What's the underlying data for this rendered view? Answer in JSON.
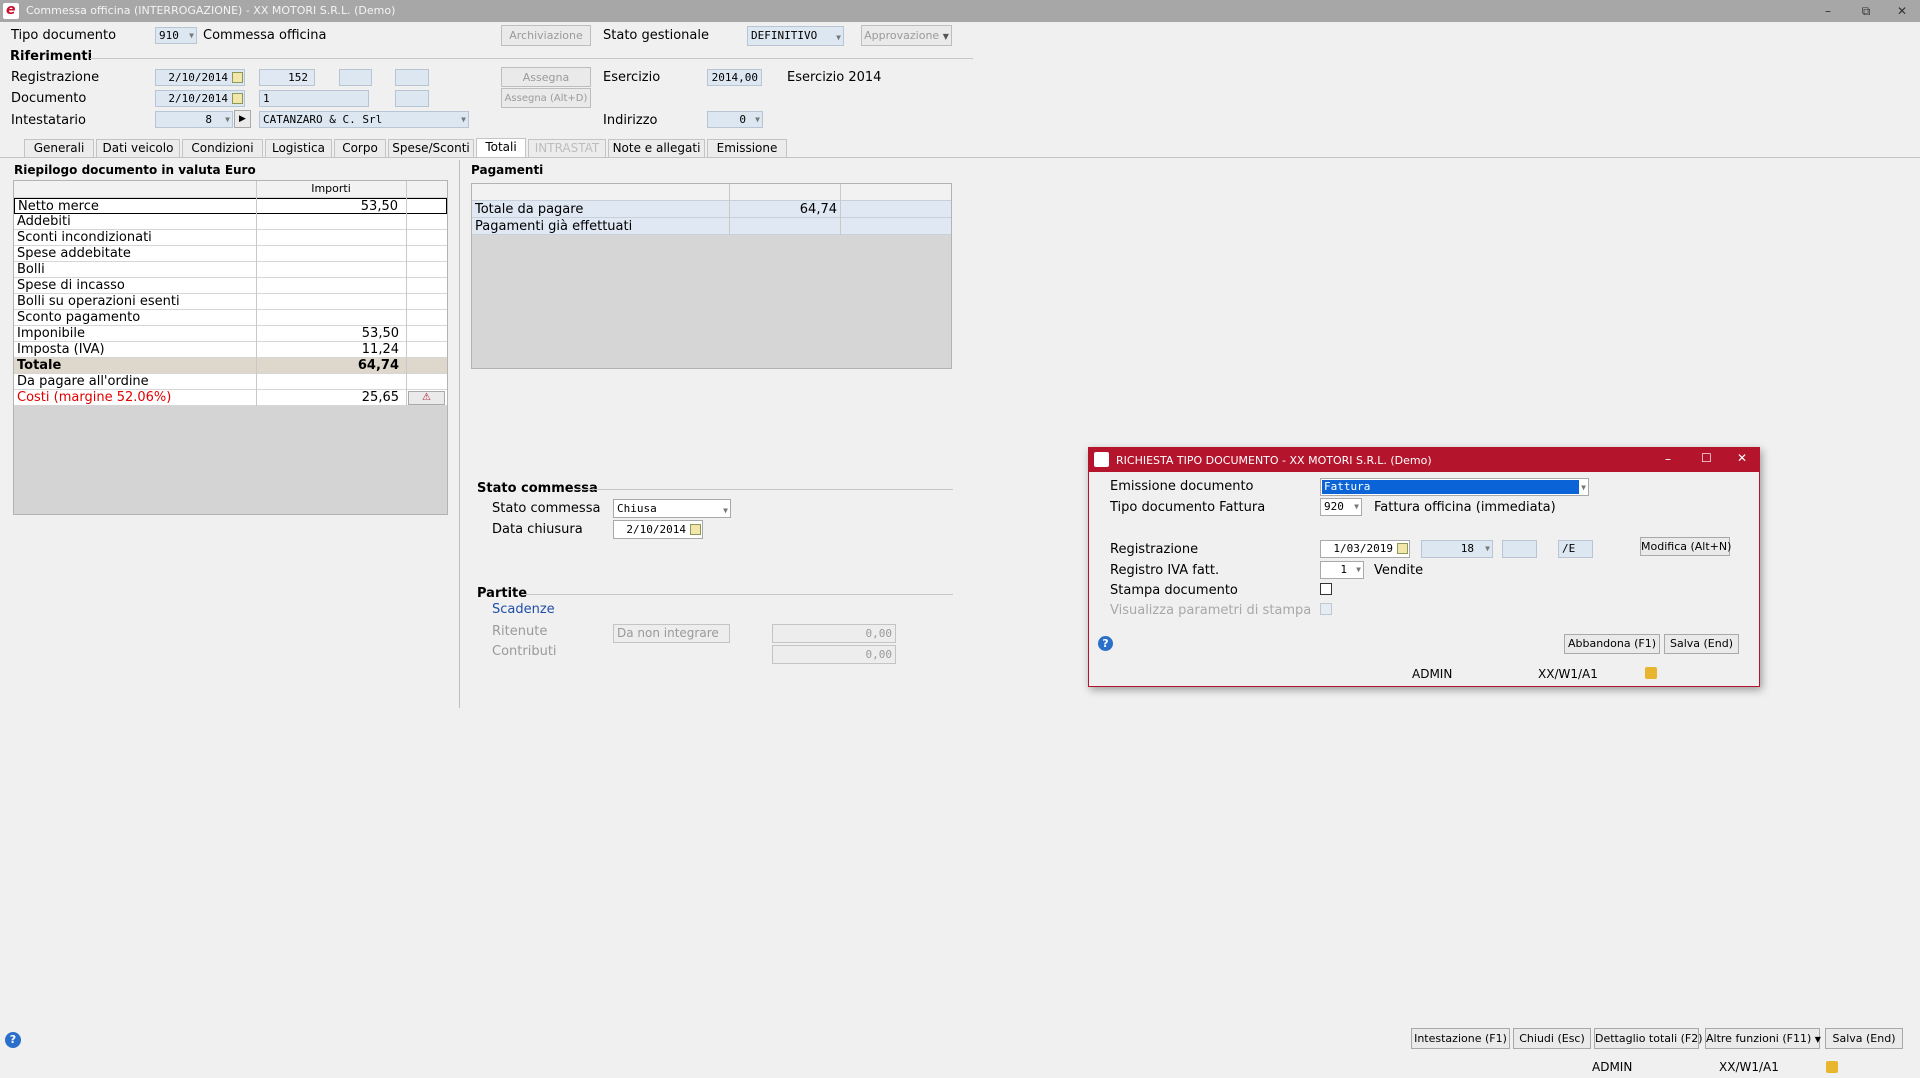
{
  "window": {
    "title": "Commessa officina (INTERROGAZIONE) - XX  MOTORI S.R.L.  (Demo)",
    "minimize": "–",
    "restore": "⧉",
    "close": "✕"
  },
  "header": {
    "tipo_documento_label": "Tipo documento",
    "tipo_documento_code": "910",
    "tipo_documento_desc": "Commessa officina",
    "archiviazione_button": "Archiviazione",
    "stato_gestionale_label": "Stato gestionale",
    "stato_gestionale_value": "DEFINITIVO",
    "approvazione_button": "Approvazione",
    "riferimenti_label": "Riferimenti",
    "registrazione_label": "Registrazione",
    "registrazione_date": "2/10/2014",
    "registrazione_number": "152",
    "assegna_button": "Assegna",
    "esercizio_label": "Esercizio",
    "esercizio_value": "2014,00",
    "esercizio_desc": "Esercizio 2014",
    "documento_label": "Documento",
    "documento_date": "2/10/2014",
    "documento_number": "1",
    "assegna_alt_button": "Assegna (Alt+D)",
    "intestatario_label": "Intestatario",
    "intestatario_code": "8",
    "intestatario_name": "CATANZARO & C. Srl",
    "indirizzo_label": "Indirizzo",
    "indirizzo_value": "0"
  },
  "tabs": [
    {
      "label": "Generali"
    },
    {
      "label": "Dati veicolo"
    },
    {
      "label": "Condizioni"
    },
    {
      "label": "Logistica"
    },
    {
      "label": "Corpo"
    },
    {
      "label": "Spese/Sconti"
    },
    {
      "label": "Totali"
    },
    {
      "label": "INTRASTAT"
    },
    {
      "label": "Note e allegati"
    },
    {
      "label": "Emissione"
    }
  ],
  "riepilogo": {
    "title": "Riepilogo documento in valuta Euro",
    "col_importi": "Importi",
    "rows": [
      {
        "label": "Netto merce",
        "value": "53,50"
      },
      {
        "label": "Addebiti",
        "value": ""
      },
      {
        "label": "Sconti incondizionati",
        "value": ""
      },
      {
        "label": "Spese addebitate",
        "value": ""
      },
      {
        "label": "Bolli",
        "value": ""
      },
      {
        "label": "Spese di incasso",
        "value": ""
      },
      {
        "label": "Bolli su operazioni esenti",
        "value": ""
      },
      {
        "label": "Sconto pagamento",
        "value": ""
      },
      {
        "label": "Imponibile",
        "value": "53,50"
      },
      {
        "label": "Imposta (IVA)",
        "value": "11,24"
      },
      {
        "label": "Totale",
        "value": "64,74"
      },
      {
        "label": "Da pagare all'ordine",
        "value": ""
      },
      {
        "label": "Costi (margine 52.06%)",
        "value": "25,65"
      }
    ]
  },
  "pagamenti": {
    "title": "Pagamenti",
    "rows": [
      {
        "label": "Totale da pagare",
        "value": "64,74"
      },
      {
        "label": "Pagamenti già effettuati",
        "value": ""
      }
    ]
  },
  "stato_commessa": {
    "section_label": "Stato commessa",
    "stato_label": "Stato commessa",
    "stato_value": "Chiusa",
    "data_chiusura_label": "Data chiusura",
    "data_chiusura_value": "2/10/2014"
  },
  "partite": {
    "section_label": "Partite",
    "scadenze_link": "Scadenze",
    "ritenute_label": "Ritenute",
    "ritenute_select": "Da non integrare",
    "ritenute_value": "0,00",
    "contributi_label": "Contributi",
    "contributi_value": "0,00"
  },
  "dialog": {
    "title": "RICHIESTA TIPO DOCUMENTO - XX  MOTORI S.R.L.  (Demo)",
    "emissione_label": "Emissione documento",
    "emissione_value": "Fattura",
    "tipo_fattura_label": "Tipo documento Fattura",
    "tipo_fattura_code": "920",
    "tipo_fattura_desc": "Fattura officina (immediata)",
    "registrazione_label": "Registrazione",
    "registrazione_date": "1/03/2019",
    "registrazione_number": "18",
    "registrazione_suffix": "/E",
    "modifica_button": "Modifica (Alt+N)",
    "registro_iva_label": "Registro IVA fatt.",
    "registro_iva_value": "1",
    "registro_iva_desc": "Vendite",
    "stampa_label": "Stampa documento",
    "visualizza_label": "Visualizza parametri di stampa",
    "abbandona_button": "Abbandona (F1)",
    "salva_button": "Salva (End)",
    "status_user": "ADMIN",
    "status_path": "XX/W1/A1"
  },
  "footer": {
    "intestazione_button": "Intestazione (F1)",
    "chiudi_button": "Chiudi (Esc)",
    "dettaglio_button": "Dettaglio totali (F2)",
    "altre_button": "Altre funzioni (F11)",
    "salva_button": "Salva (End)",
    "status_user": "ADMIN",
    "status_path": "XX/W1/A1"
  },
  "colors": {
    "accent_red": "#b5142d",
    "selection_blue": "#0a64d8",
    "field_blue": "#dde7f2",
    "link_blue": "#1f4ea8",
    "alert_red": "#e00000"
  }
}
